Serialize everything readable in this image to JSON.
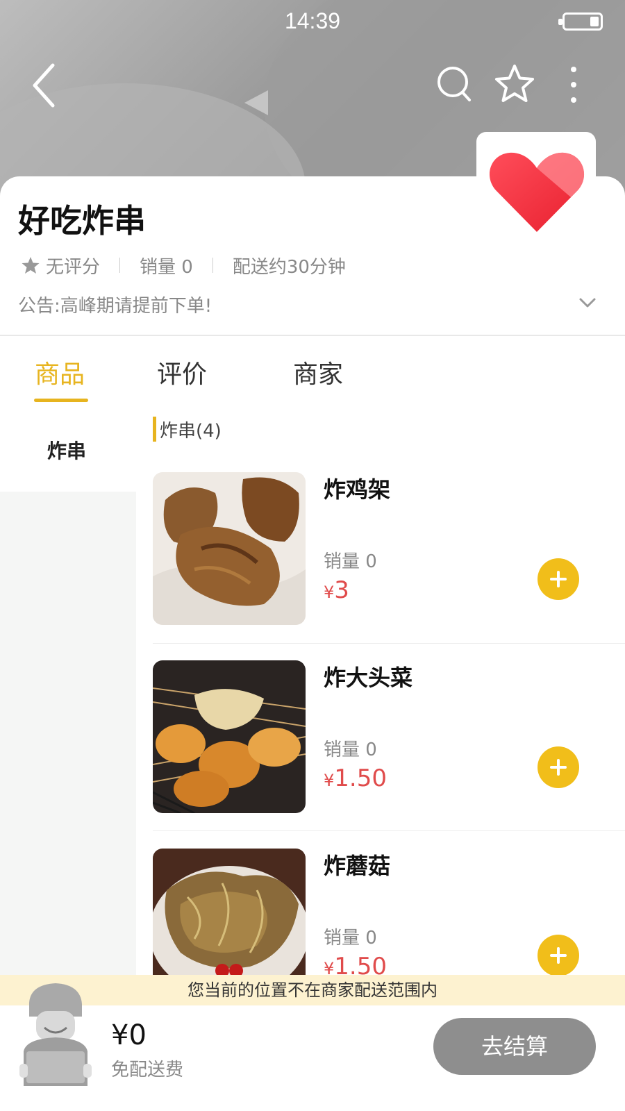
{
  "status_bar": {
    "time": "14:39"
  },
  "header": {
    "icons": [
      "back-icon",
      "search-icon",
      "star-icon",
      "more-icon"
    ]
  },
  "shop": {
    "name": "好吃炸串",
    "rating": "无评分",
    "sales": "销量 0",
    "delivery": "配送约30分钟",
    "notice": "公告:高峰期请提前下单!"
  },
  "tabs": [
    {
      "label": "商品",
      "active": true
    },
    {
      "label": "评价",
      "active": false
    },
    {
      "label": "商家",
      "active": false
    }
  ],
  "sidebar": {
    "items": [
      {
        "label": "炸串",
        "active": true
      }
    ]
  },
  "section": {
    "title": "炸串(4)"
  },
  "products": [
    {
      "name": "炸鸡架",
      "sales": "销量 0",
      "currency": "¥",
      "price": "3"
    },
    {
      "name": "炸大头菜",
      "sales": "销量 0",
      "currency": "¥",
      "price": "1.50"
    },
    {
      "name": "炸蘑菇",
      "sales": "销量 0",
      "currency": "¥",
      "price": "1.50"
    }
  ],
  "warning": "您当前的位置不在商家配送范围内",
  "cart": {
    "total": "¥0",
    "fee": "免配送费",
    "checkout_label": "去结算"
  },
  "colors": {
    "accent": "#e7b41f",
    "price": "#e04b4b",
    "add_button": "#f1be1a",
    "checkout_disabled": "#8e8e8e",
    "warning_bg": "#fdf2d0"
  }
}
